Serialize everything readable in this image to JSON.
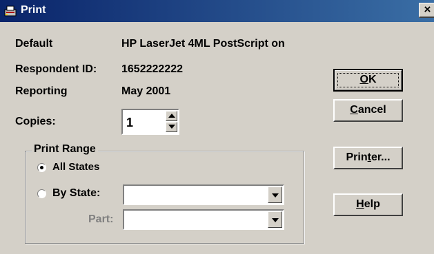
{
  "window": {
    "title": "Print",
    "close_glyph": "×"
  },
  "info": {
    "default_label": "Default",
    "default_value": "HP LaserJet 4ML PostScript on",
    "respondent_label": "Respondent ID:",
    "respondent_value": "1652222222",
    "reporting_label": "Reporting",
    "reporting_value": "May 2001"
  },
  "copies": {
    "label": "Copies:",
    "value": "1"
  },
  "buttons": {
    "ok_prefix": "",
    "ok_hotkey": "O",
    "ok_suffix": "K",
    "cancel_prefix": "",
    "cancel_hotkey": "C",
    "cancel_suffix": "ancel",
    "printer_prefix": "Prin",
    "printer_hotkey": "t",
    "printer_suffix": "er...",
    "help_prefix": "",
    "help_hotkey": "H",
    "help_suffix": "elp"
  },
  "print_range": {
    "title": "Print Range",
    "all_states_label": "All States",
    "by_state_label": "By State:",
    "part_label": "Part:",
    "selected": "All States",
    "state_value": "",
    "part_value": ""
  },
  "colors": {
    "face": "#d4d0c8",
    "titlebar_start": "#0a246a",
    "titlebar_end": "#3a6ea5",
    "disabled_text": "#808080"
  }
}
